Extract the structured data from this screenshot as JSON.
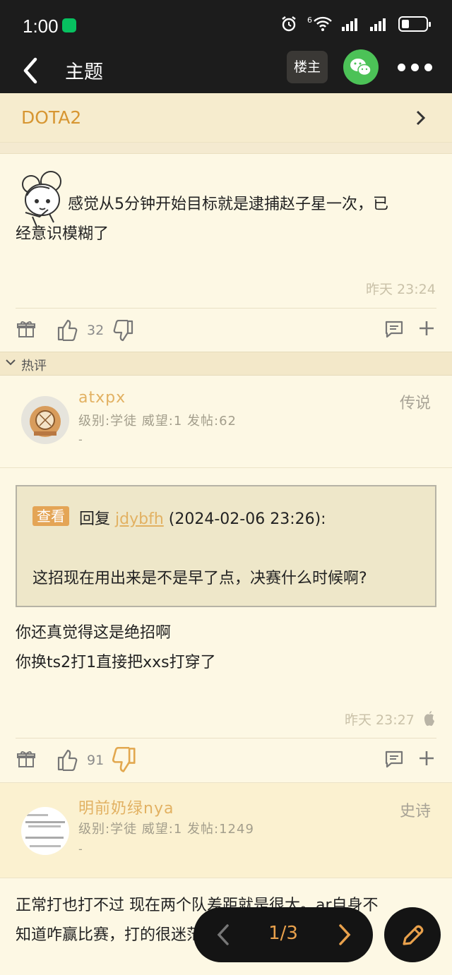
{
  "status_bar": {
    "time": "1:00",
    "network": "6"
  },
  "header": {
    "title": "主题",
    "op_button": "楼主"
  },
  "forum": {
    "name": "DOTA2"
  },
  "post1": {
    "text_line1": "感觉从5分钟开始目标就是逮捕赵子星一次，已",
    "text_line2": "经意识模糊了",
    "time": "昨天 23:24",
    "likes": "32"
  },
  "hot_section": {
    "label": "热评"
  },
  "reply1": {
    "user": {
      "name": "atxpx",
      "meta": "级别:学徒 威望:1 发帖:62",
      "signature": "-",
      "rank": "传说"
    },
    "quote": {
      "view_label": "查看",
      "reply_prefix": "回复",
      "reply_user": "jdybfh",
      "reply_time": "(2024-02-06 23:26):",
      "text": "这招现在用出来是不是早了点，决赛什么时候啊?"
    },
    "text_line1": "你还真觉得这是绝招啊",
    "text_line2": "你换ts2打1直接把xxs打穿了",
    "time": "昨天 23:27",
    "likes": "91"
  },
  "reply2": {
    "user": {
      "name": "明前奶绿nya",
      "meta": "级别:学徒 威望:1 发帖:1249",
      "signature": "-",
      "rank": "史诗"
    },
    "text_line1": "正常打也打不过 现在两个队差距就是很大。ar自身不",
    "text_line2": "知道咋赢比赛，打的很迷茫。"
  },
  "pager": {
    "page": "1/3"
  },
  "colors": {
    "accent": "#e9a14c",
    "username": "#e2b162",
    "wechat": "#4cc257"
  }
}
